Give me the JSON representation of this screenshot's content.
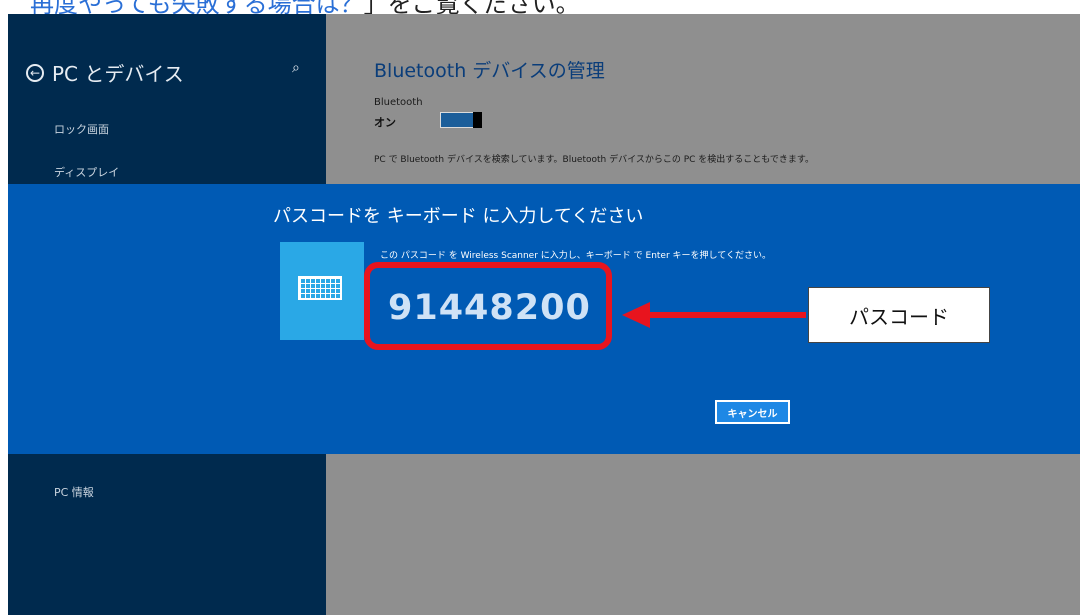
{
  "caption": {
    "link_text": "再度やっても失敗する場合は？",
    "tail": "」をご覧ください。"
  },
  "sidebar": {
    "title": "PC とデバイス",
    "items": [
      {
        "label": "ロック画面"
      },
      {
        "label": "ディスプレイ"
      },
      {
        "label": "PC 情報"
      }
    ]
  },
  "main": {
    "title": "Bluetooth デバイスの管理",
    "bluetooth_label": "Bluetooth",
    "bluetooth_state": "オン",
    "status_text": "PC で Bluetooth デバイスを検索しています。Bluetooth デバイスからこの PC を検出することもできます。"
  },
  "dialog": {
    "title": "パスコードを キーボード に入力してください",
    "instruction": "この パスコード を Wireless Scanner に入力し、キーボード で Enter キーを押してください。",
    "passcode": "91448200",
    "cancel_label": "キャンセル"
  },
  "annotation": {
    "label": "パスコード"
  },
  "icons": [
    "back-arrow-icon",
    "search-icon",
    "keyboard-icon"
  ],
  "colors": {
    "sidebar": "#002a4e",
    "dialog": "#005ab4",
    "highlight": "#e8141e",
    "tile": "#2aa8e6"
  }
}
